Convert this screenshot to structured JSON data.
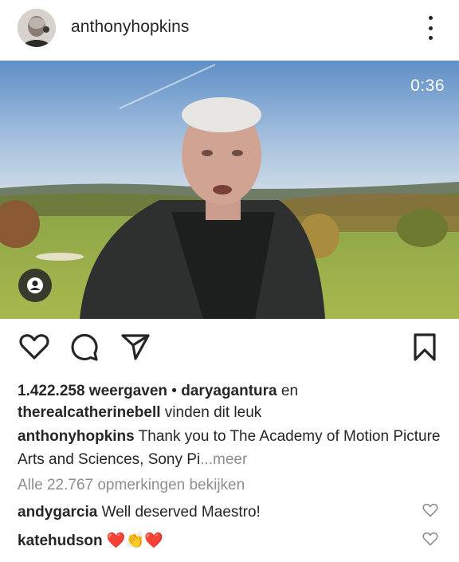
{
  "post": {
    "username": "anthonyhopkins",
    "video_time": "0:36"
  },
  "likes": {
    "views": "1.422.258 weergaven",
    "sep": " • ",
    "user1": "daryagantura",
    "and": " en",
    "user2": "therealcatherinebell",
    "suffix": " vinden dit leuk"
  },
  "caption": {
    "username": "anthonyhopkins",
    "text": " Thank you to The Academy of Motion Picture Arts and Sciences, Sony Pi",
    "more": "...meer"
  },
  "comments_link": "Alle 22.767 opmerkingen bekijken",
  "comments": [
    {
      "username": "andygarcia",
      "text": " Well deserved Maestro!"
    },
    {
      "username": "katehudson",
      "text": " ❤️👏❤️"
    }
  ],
  "icons": {
    "like": "heart-icon",
    "comment": "comment-icon",
    "share": "send-icon",
    "save": "bookmark-icon",
    "tagged": "user-icon",
    "options": "more-vertical-icon"
  }
}
